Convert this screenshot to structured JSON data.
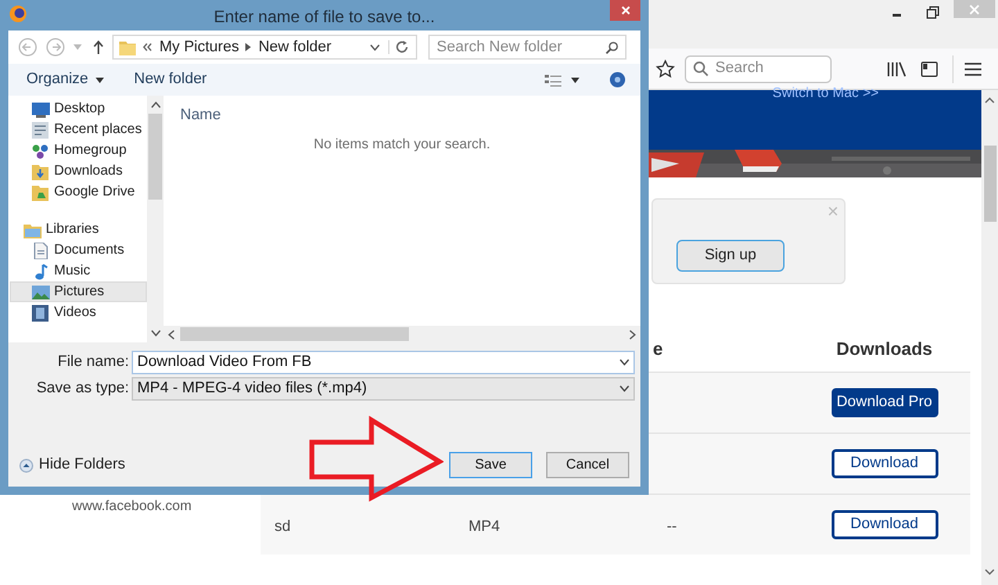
{
  "browser": {
    "search_placeholder": "Search",
    "banner_text": "Switch to Mac >>"
  },
  "signup_popup": {
    "close": "×",
    "button": "Sign up"
  },
  "page_text": "www.facebook.com",
  "table": {
    "header_column_3": "e",
    "header_downloads": "Downloads",
    "rows": [
      {
        "button": {
          "label": "Download Pro",
          "kind": "filled"
        }
      },
      {
        "button": {
          "label": "Download",
          "kind": "outline"
        }
      },
      {
        "column_1": "sd",
        "column_2": "MP4",
        "column_3": "--",
        "button": {
          "label": "Download",
          "kind": "outline"
        }
      }
    ]
  },
  "dialog": {
    "title": "Enter name of file to save to...",
    "address": [
      "My Pictures",
      "New folder"
    ],
    "search_placeholder": "Search New folder",
    "toolbar": {
      "organize": "Organize",
      "new_folder": "New folder"
    },
    "nav_items": [
      {
        "label": "Desktop",
        "selected": false
      },
      {
        "label": "Recent places",
        "selected": false
      },
      {
        "label": "Homegroup",
        "selected": false
      },
      {
        "label": "Downloads",
        "selected": false
      },
      {
        "label": "Google Drive",
        "selected": false
      },
      {
        "label": "Libraries",
        "selected": false,
        "children": [
          {
            "label": "Documents",
            "selected": false
          },
          {
            "label": "Music",
            "selected": false
          },
          {
            "label": "Pictures",
            "selected": true
          },
          {
            "label": "Videos",
            "selected": false
          }
        ]
      }
    ],
    "list": {
      "column": "Name",
      "empty_message": "No items match your search."
    },
    "file_name": {
      "label": "File name:",
      "value": "Download Video From FB"
    },
    "save_type": {
      "label": "Save as type:",
      "value": "MP4 - MPEG-4 video files (*.mp4)"
    },
    "hide_folders": "Hide Folders",
    "buttons": [
      {
        "label": "Save",
        "default": true
      },
      {
        "label": "Cancel",
        "default": false
      }
    ]
  }
}
